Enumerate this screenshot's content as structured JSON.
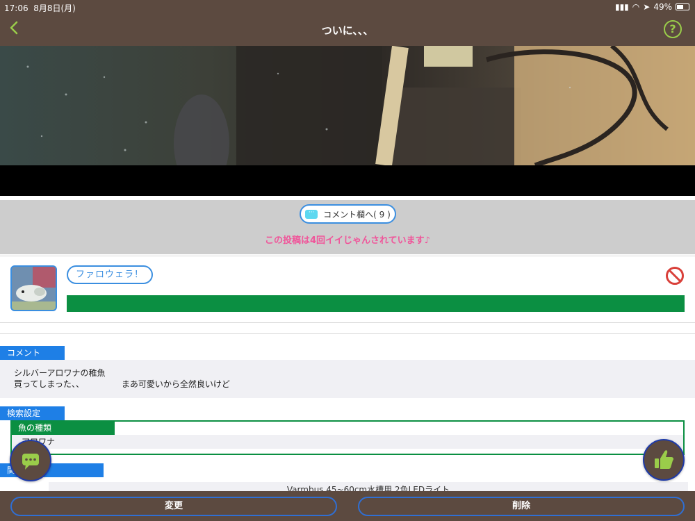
{
  "status_bar": {
    "time": "17:06",
    "date": "8月8日(月)",
    "battery": "49%"
  },
  "header": {
    "title": "ついに、、、",
    "back_icon": "chevron-left-icon",
    "help_label": "?"
  },
  "comment_link": {
    "label": "コメント欄へ( 9 )",
    "icon": "chat-icon"
  },
  "like_status": "この投稿は4回イイじゃんされています♪",
  "user": {
    "name": "ファロウェラ！",
    "block_icon": "block-icon"
  },
  "comment_section": {
    "label": "コメント",
    "line1": "シルバーアロワナの稚魚",
    "line2": "買ってしまった、、　　　　　まあ可愛いから全然良いけど"
  },
  "search_settings": {
    "label": "検索設定",
    "fish_type_label": "魚の種類",
    "fish_type_value": "アロワナ"
  },
  "related_links": {
    "label": "関連リンク",
    "item": "Varmbus 45~60cm水槽用 2色LEDライト"
  },
  "footer": {
    "change_label": "変更",
    "delete_label": "削除"
  },
  "colors": {
    "brown": "#5c4a40",
    "accent_green": "#9acd4a",
    "blue": "#1e7fe6",
    "green": "#0b8f42",
    "pink": "#f0559a"
  }
}
